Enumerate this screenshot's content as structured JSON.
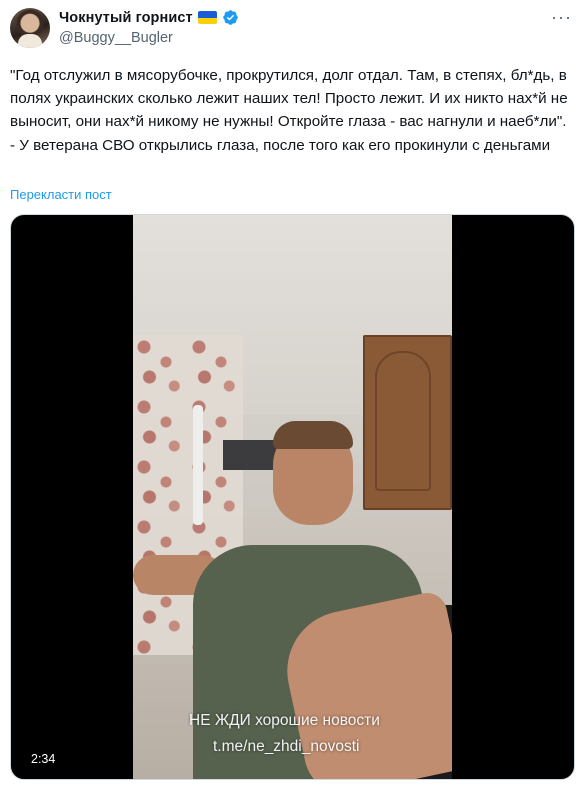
{
  "author": {
    "display_name": "Чокнутый горнист",
    "handle": "@Buggy__Bugler",
    "flag_colors": [
      "#1a5dd6",
      "#f7d10a"
    ],
    "verified_badge_color": "#1d9bf0",
    "avatar_icon": "user-avatar"
  },
  "menu_icon": "more-horizontal-icon",
  "tweet": {
    "text": "\"Год отслужил в мясорубочке, прокрутился, долг отдал. Там, в степях, бл*дь, в полях украинских сколько лежит наших тел! Просто лежит. И их никто нах*й не выносит, они нах*й никому не нужны! Откройте глаза - вас нагнули и наеб*ли\". - У ветерана СВО открылись глаза, после того как его прокинули с деньгами",
    "translate_label": "Перекласти пост"
  },
  "media": {
    "overlay_line1": "НЕ ЖДИ хорошие новости",
    "overlay_line2": "t.me/ne_zhdi_novosti",
    "duration": "2:34"
  },
  "colors": {
    "link": "#1d9bf0",
    "secondary_text": "#536471",
    "primary_text": "#0f1419"
  }
}
